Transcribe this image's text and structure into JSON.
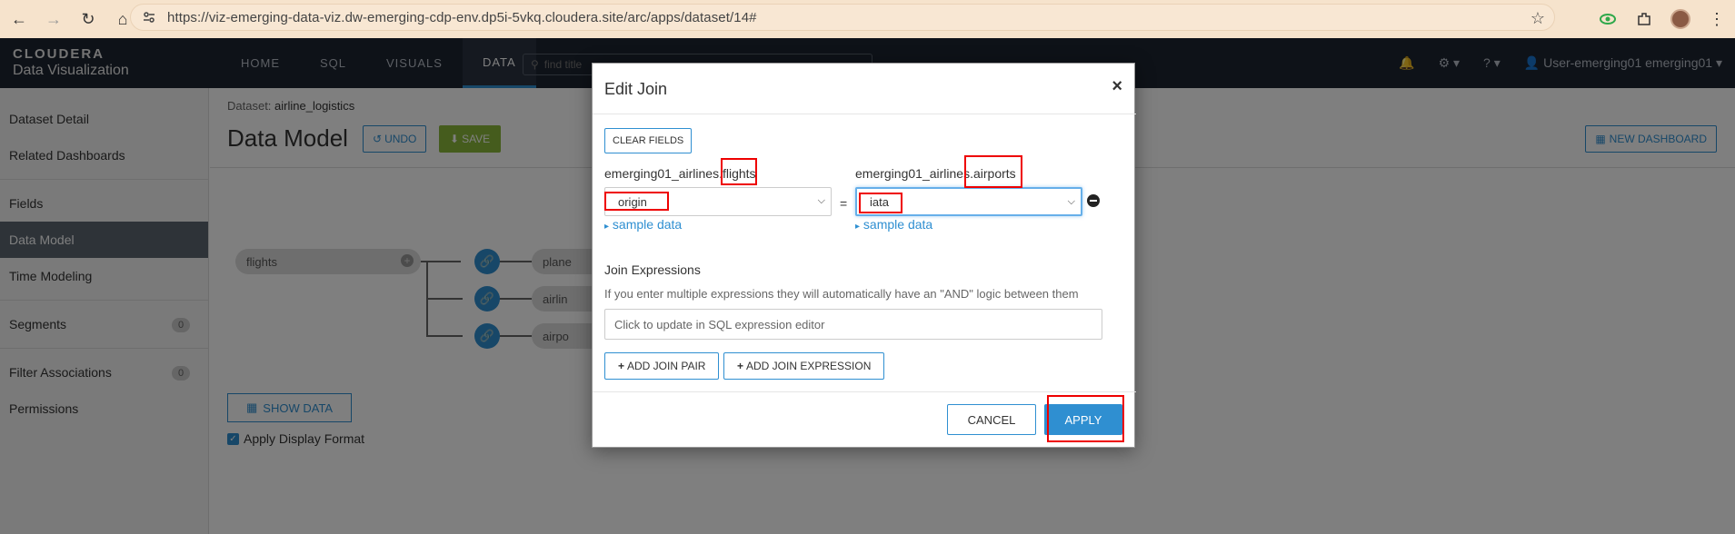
{
  "browser": {
    "url": "https://viz-emerging-data-viz.dw-emerging-cdp-env.dp5i-5vkq.cloudera.site/arc/apps/dataset/14#"
  },
  "header": {
    "logo_line1": "CLOUDERA",
    "logo_line2": "Data Visualization",
    "nav": [
      "HOME",
      "SQL",
      "VISUALS",
      "DATA"
    ],
    "find_placeholder": "find title",
    "user": "User-emerging01 emerging01"
  },
  "sidebar": {
    "items": [
      {
        "label": "Dataset Detail"
      },
      {
        "label": "Related Dashboards"
      },
      {
        "label": "Fields"
      },
      {
        "label": "Data Model"
      },
      {
        "label": "Time Modeling"
      },
      {
        "label": "Segments",
        "badge": "0"
      },
      {
        "label": "Filter Associations",
        "badge": "0"
      },
      {
        "label": "Permissions"
      }
    ]
  },
  "main": {
    "crumb_label": "Dataset:",
    "crumb_value": "airline_logistics",
    "title": "Data Model",
    "undo": "UNDO",
    "save": "SAVE",
    "new_dashboard": "NEW DASHBOARD",
    "root_node": "flights",
    "child_nodes": [
      "plane",
      "airlin",
      "airpo"
    ],
    "show_data": "SHOW DATA",
    "apply_format": "Apply Display Format"
  },
  "modal": {
    "title": "Edit Join",
    "close": "×",
    "clear_fields": "CLEAR FIELDS",
    "left_prefix": "emerging01_airlines.",
    "left_table": "flights",
    "right_prefix": "emerging01_airlines.",
    "right_table": "airports",
    "left_field": "origin",
    "right_field": "iata",
    "equals": "=",
    "sample_left": "sample data",
    "sample_right": "sample data",
    "join_expr_title": "Join Expressions",
    "join_expr_help": "If you enter multiple expressions they will automatically have an \"AND\" logic between them",
    "expr_placeholder": "Click to update in SQL expression editor",
    "add_join_pair": "ADD JOIN PAIR",
    "add_join_expression": "ADD JOIN EXPRESSION",
    "cancel": "CANCEL",
    "apply": "APPLY"
  }
}
